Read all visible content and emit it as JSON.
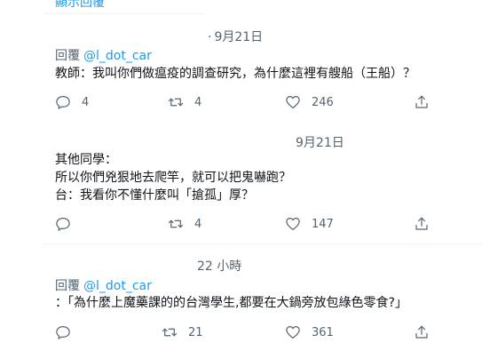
{
  "top_cut_text": "顯示回覆",
  "tweets": [
    {
      "time": "9月21日",
      "reply_prefix": "回覆",
      "reply_handle": "@l_dot_car",
      "lines": [
        "教師：我叫你們做瘟疫的調查研究，為什麼這裡有艘船（王船）？"
      ],
      "replies": "4",
      "retweets": "4",
      "likes": "246"
    },
    {
      "time": "9月21日",
      "lines": [
        "其他同學：",
        "所以你們兇狠地去爬竿，就可以把鬼嚇跑？",
        "台：我看你不懂什麼叫「搶孤」厚？"
      ],
      "replies": "",
      "retweets": "4",
      "likes": "147"
    },
    {
      "time": "22 小時",
      "reply_prefix": "回覆",
      "reply_handle": "@l_dot_car",
      "lines": [
        "：「為什麼上魔藥課的的台灣學生,都要在大鍋旁放包綠色零食?」"
      ],
      "replies": "",
      "retweets": "21",
      "likes": "361"
    }
  ],
  "icons": {
    "reply": "reply-icon",
    "retweet": "retweet-icon",
    "like": "heart-icon",
    "share": "share-icon"
  }
}
